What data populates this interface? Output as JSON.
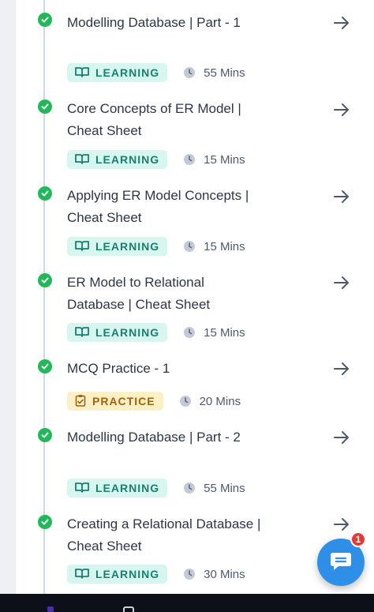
{
  "items": [
    {
      "title": "Modelling Database | Part - 1",
      "tag": "LEARNING",
      "duration": "55 Mins",
      "icon": "book-icon"
    },
    {
      "title": "Core Concepts of ER Model | Cheat Sheet",
      "tag": "LEARNING",
      "duration": "15 Mins",
      "icon": "book-icon"
    },
    {
      "title": "Applying ER Model Concepts | Cheat Sheet",
      "tag": "LEARNING",
      "duration": "15 Mins",
      "icon": "book-icon"
    },
    {
      "title": "ER Model to Relational Database | Cheat Sheet",
      "tag": "LEARNING",
      "duration": "15 Mins",
      "icon": "book-icon"
    },
    {
      "title": "MCQ Practice - 1",
      "tag": "PRACTICE",
      "duration": "20 Mins",
      "icon": "clipboard-icon"
    },
    {
      "title": "Modelling Database | Part - 2",
      "tag": "LEARNING",
      "duration": "55 Mins",
      "icon": "book-icon"
    },
    {
      "title": "Creating a Relational Database | Cheat Sheet",
      "tag": "LEARNING",
      "duration": "30 Mins",
      "icon": "book-icon"
    }
  ],
  "chat": {
    "badge_count": "1",
    "icon": "chat-icon"
  },
  "colors": {
    "done": "#22b85a",
    "learning_bg": "#d7f6ef",
    "learning_fg": "#18806f",
    "practice_bg": "#fdf0c7",
    "practice_fg": "#a0620b",
    "chat": "#2f8fe6",
    "badge": "#e53935"
  }
}
